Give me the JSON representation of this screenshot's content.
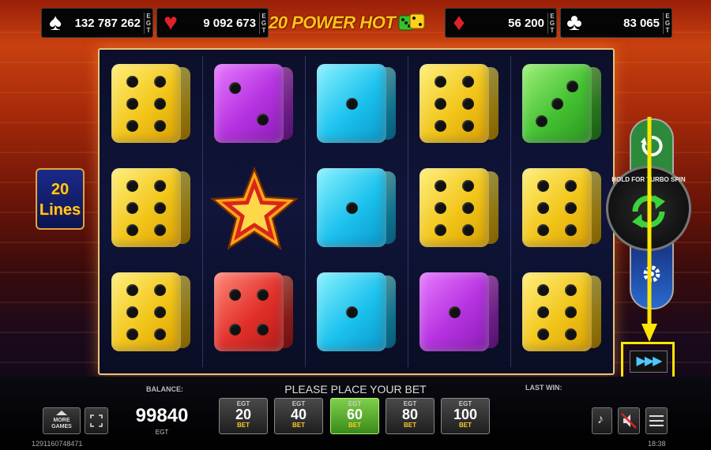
{
  "jackpots": [
    {
      "suit": "spades",
      "symbol": "♠",
      "color": "#ffffff",
      "amount": "132 787 262",
      "tag": "EGT"
    },
    {
      "suit": "hearts",
      "symbol": "♥",
      "color": "#e0202a",
      "amount": "9 092 673",
      "tag": "EGT"
    },
    {
      "suit": "diamonds",
      "symbol": "♦",
      "color": "#e0202a",
      "amount": "56 200",
      "tag": "EGT"
    },
    {
      "suit": "clubs",
      "symbol": "♣",
      "color": "#ffffff",
      "amount": "83 065",
      "tag": "EGT"
    }
  ],
  "logo": {
    "text": "20 POWER HOT"
  },
  "lines": {
    "count": "20",
    "label": "Lines"
  },
  "reels": [
    [
      {
        "type": "die",
        "color": "yellow",
        "value": 6
      },
      {
        "type": "die",
        "color": "yellow",
        "value": 6
      },
      {
        "type": "die",
        "color": "yellow",
        "value": 6
      }
    ],
    [
      {
        "type": "die",
        "color": "purple",
        "value": 2
      },
      {
        "type": "star"
      },
      {
        "type": "die",
        "color": "red",
        "value": 4
      }
    ],
    [
      {
        "type": "die",
        "color": "cyan",
        "value": 1
      },
      {
        "type": "die",
        "color": "cyan",
        "value": 1
      },
      {
        "type": "die",
        "color": "cyan",
        "value": 1
      }
    ],
    [
      {
        "type": "die",
        "color": "yellow",
        "value": 6
      },
      {
        "type": "die",
        "color": "yellow",
        "value": 6
      },
      {
        "type": "die",
        "color": "purple",
        "value": 1
      }
    ],
    [
      {
        "type": "die",
        "color": "green",
        "value": 3
      },
      {
        "type": "die",
        "color": "yellow",
        "value": 6
      },
      {
        "type": "die",
        "color": "yellow",
        "value": 6
      }
    ]
  ],
  "controls": {
    "spin_hint": "HOLD FOR TURBO SPIN",
    "turbo_symbol": "▶▶▶"
  },
  "bottom": {
    "balance_label": "BALANCE:",
    "balance_value": "99840",
    "balance_currency": "EGT",
    "message": "PLEASE PLACE YOUR BET",
    "last_win_label": "LAST WIN:",
    "more_games": "MORE GAMES",
    "bets": [
      {
        "tag": "EGT",
        "value": "20",
        "label": "BET",
        "active": false
      },
      {
        "tag": "EGT",
        "value": "40",
        "label": "BET",
        "active": false
      },
      {
        "tag": "EGT",
        "value": "60",
        "label": "BET",
        "active": true
      },
      {
        "tag": "EGT",
        "value": "80",
        "label": "BET",
        "active": false
      },
      {
        "tag": "EGT",
        "value": "100",
        "label": "BET",
        "active": false
      }
    ],
    "ticket_id": "1291160748471",
    "clock": "18:38"
  }
}
